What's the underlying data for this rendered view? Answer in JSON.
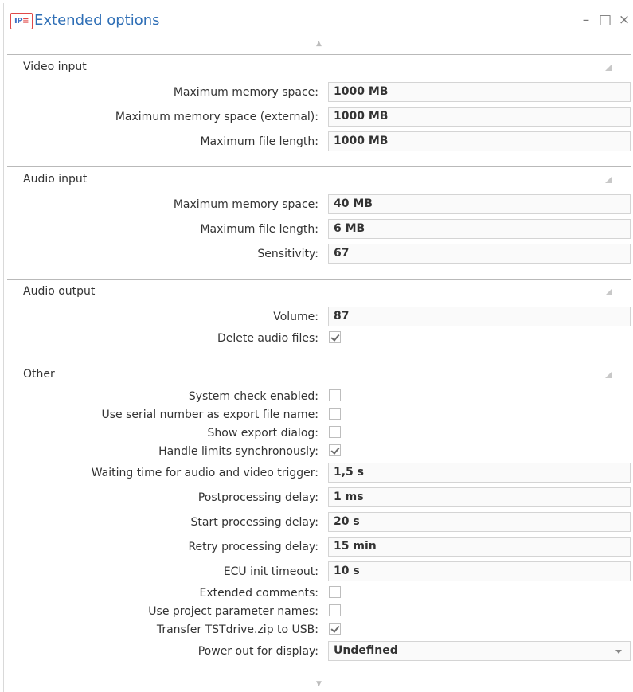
{
  "window": {
    "title": "Extended options",
    "icon": "ipe-app-icon",
    "controls": [
      "minimize-icon",
      "maximize-icon",
      "close-icon"
    ]
  },
  "sections": [
    {
      "title": "Video input",
      "rows": [
        {
          "label": "Maximum memory space:",
          "type": "text",
          "value": "1000 MB"
        },
        {
          "label": "Maximum memory space (external):",
          "type": "text",
          "value": "1000 MB"
        },
        {
          "label": "Maximum file length:",
          "type": "text",
          "value": "1000 MB"
        }
      ]
    },
    {
      "title": "Audio input",
      "rows": [
        {
          "label": "Maximum memory space:",
          "type": "text",
          "value": "40 MB"
        },
        {
          "label": "Maximum file length:",
          "type": "text",
          "value": "6 MB"
        },
        {
          "label": "Sensitivity:",
          "type": "text",
          "value": "67"
        }
      ]
    },
    {
      "title": "Audio output",
      "rows": [
        {
          "label": "Volume:",
          "type": "text",
          "value": "87"
        },
        {
          "label": "Delete audio files:",
          "type": "checkbox",
          "checked": true
        }
      ]
    },
    {
      "title": "Other",
      "rows": [
        {
          "label": "System check enabled:",
          "type": "checkbox",
          "checked": false
        },
        {
          "label": "Use serial number as export file name:",
          "type": "checkbox",
          "checked": false
        },
        {
          "label": "Show export dialog:",
          "type": "checkbox",
          "checked": false
        },
        {
          "label": "Handle limits synchronously:",
          "type": "checkbox",
          "checked": true
        },
        {
          "label": "Waiting time for audio and video trigger:",
          "type": "text",
          "value": "1,5 s"
        },
        {
          "label": "Postprocessing delay:",
          "type": "text",
          "value": "1 ms"
        },
        {
          "label": "Start processing delay:",
          "type": "text",
          "value": "20 s"
        },
        {
          "label": "Retry processing delay:",
          "type": "text",
          "value": "15 min"
        },
        {
          "label": "ECU init timeout:",
          "type": "text",
          "value": "10 s"
        },
        {
          "label": "Extended comments:",
          "type": "checkbox",
          "checked": false
        },
        {
          "label": "Use project parameter names:",
          "type": "checkbox",
          "checked": false
        },
        {
          "label": "Transfer TSTdrive.zip to USB:",
          "type": "checkbox",
          "checked": true
        },
        {
          "label": "Power out for display:",
          "type": "dropdown",
          "value": "Undefined"
        }
      ]
    }
  ]
}
